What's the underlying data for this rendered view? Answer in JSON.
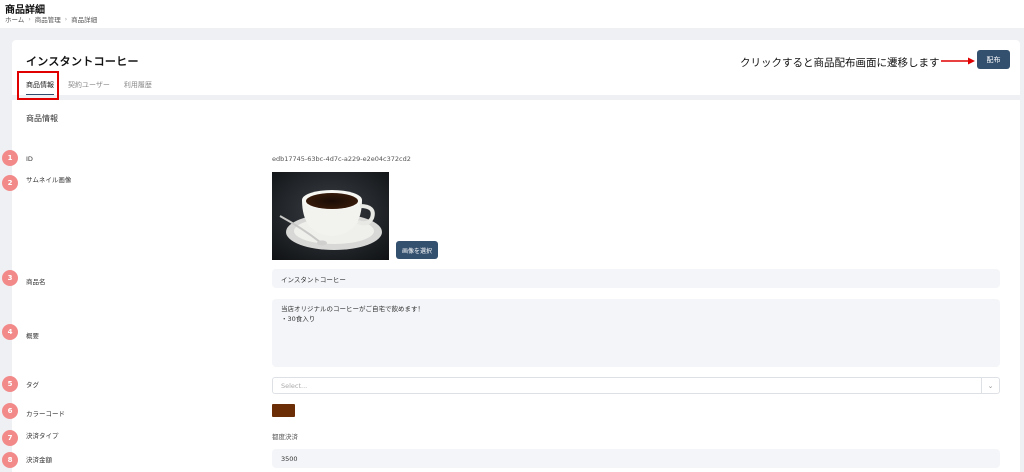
{
  "page": {
    "title": "商品詳細"
  },
  "breadcrumb": [
    "ホーム",
    "商品管理",
    "商品詳細"
  ],
  "product": {
    "name_heading": "インスタントコーヒー"
  },
  "tabs": [
    {
      "label": "商品情報",
      "active": true
    },
    {
      "label": "契約ユーザー",
      "active": false
    },
    {
      "label": "利用履歴",
      "active": false
    }
  ],
  "annotation": {
    "text": "クリックすると商品配布画面に遷移します"
  },
  "actions": {
    "deliver_label": "配布"
  },
  "section": {
    "title": "商品情報"
  },
  "fields": {
    "id": {
      "badge": "1",
      "label": "ID",
      "value": "edb17745-63bc-4d7c-a229-e2e04c372cd2"
    },
    "thumbnail": {
      "badge": "2",
      "label": "サムネイル画像",
      "button_label": "画像を選択"
    },
    "name": {
      "badge": "3",
      "label": "商品名",
      "value": "インスタントコーヒー"
    },
    "summary": {
      "badge": "4",
      "label": "概要",
      "lines": [
        "当店オリジナルのコーヒーがご自宅で飲めます！",
        "・30食入り"
      ]
    },
    "tags": {
      "badge": "5",
      "label": "タグ",
      "placeholder": "Select..."
    },
    "color": {
      "badge": "6",
      "label": "カラーコード",
      "value_hex": "#6b2d06"
    },
    "payment_type": {
      "badge": "7",
      "label": "決済タイプ",
      "value": "都度決済"
    },
    "amount": {
      "badge": "8",
      "label": "決済金額",
      "value": "3500"
    }
  },
  "colors": {
    "primary": "#34506f",
    "highlight": "#e00000",
    "badge": "#f28a8a"
  }
}
